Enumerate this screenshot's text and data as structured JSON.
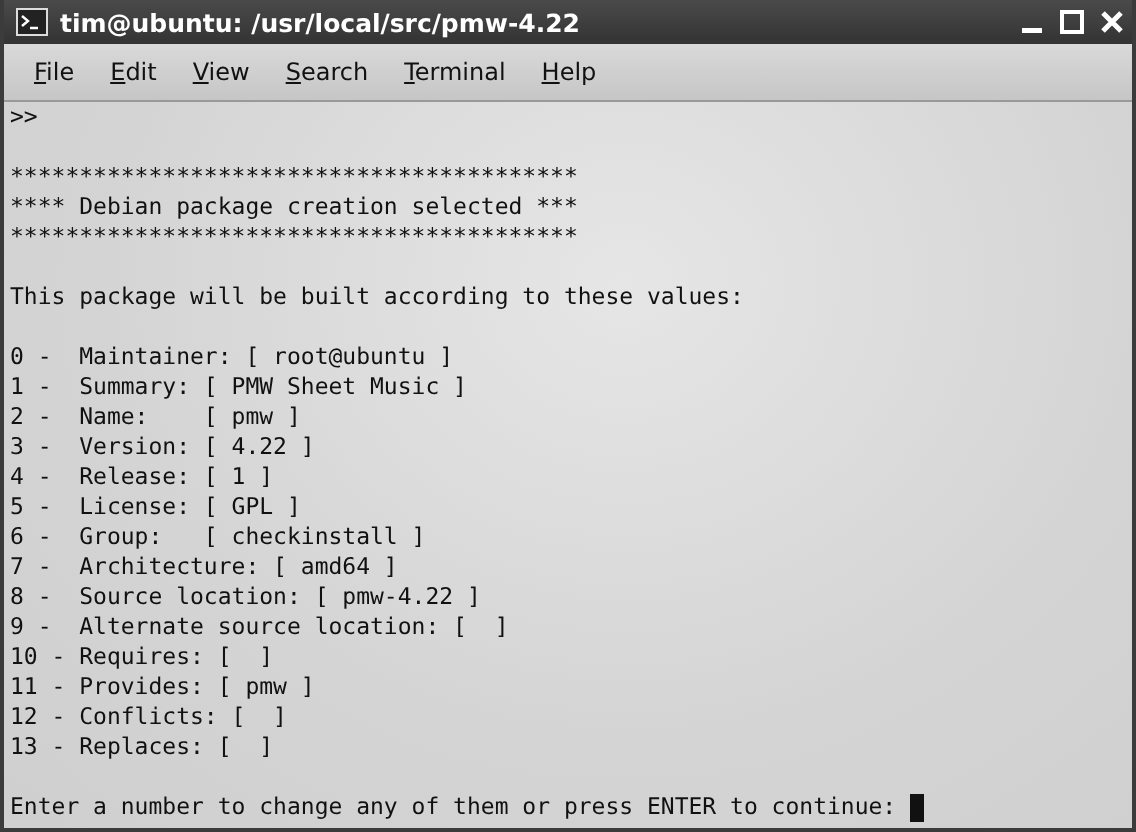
{
  "window": {
    "title": "tim@ubuntu: /usr/local/src/pmw-4.22"
  },
  "menu": [
    "File",
    "Edit",
    "View",
    "Search",
    "Terminal",
    "Help"
  ],
  "terminal": {
    "prompt_line": ">>",
    "banner": [
      "*****************************************",
      "**** Debian package creation selected ***",
      "*****************************************"
    ],
    "intro": "This package will be built according to these values:",
    "options": [
      "0 -  Maintainer: [ root@ubuntu ]",
      "1 -  Summary: [ PMW Sheet Music ]",
      "2 -  Name:    [ pmw ]",
      "3 -  Version: [ 4.22 ]",
      "4 -  Release: [ 1 ]",
      "5 -  License: [ GPL ]",
      "6 -  Group:   [ checkinstall ]",
      "7 -  Architecture: [ amd64 ]",
      "8 -  Source location: [ pmw-4.22 ]",
      "9 -  Alternate source location: [  ]",
      "10 - Requires: [  ]",
      "11 - Provides: [ pmw ]",
      "12 - Conflicts: [  ]",
      "13 - Replaces: [  ]"
    ],
    "input_prompt": "Enter a number to change any of them or press ENTER to continue: "
  }
}
